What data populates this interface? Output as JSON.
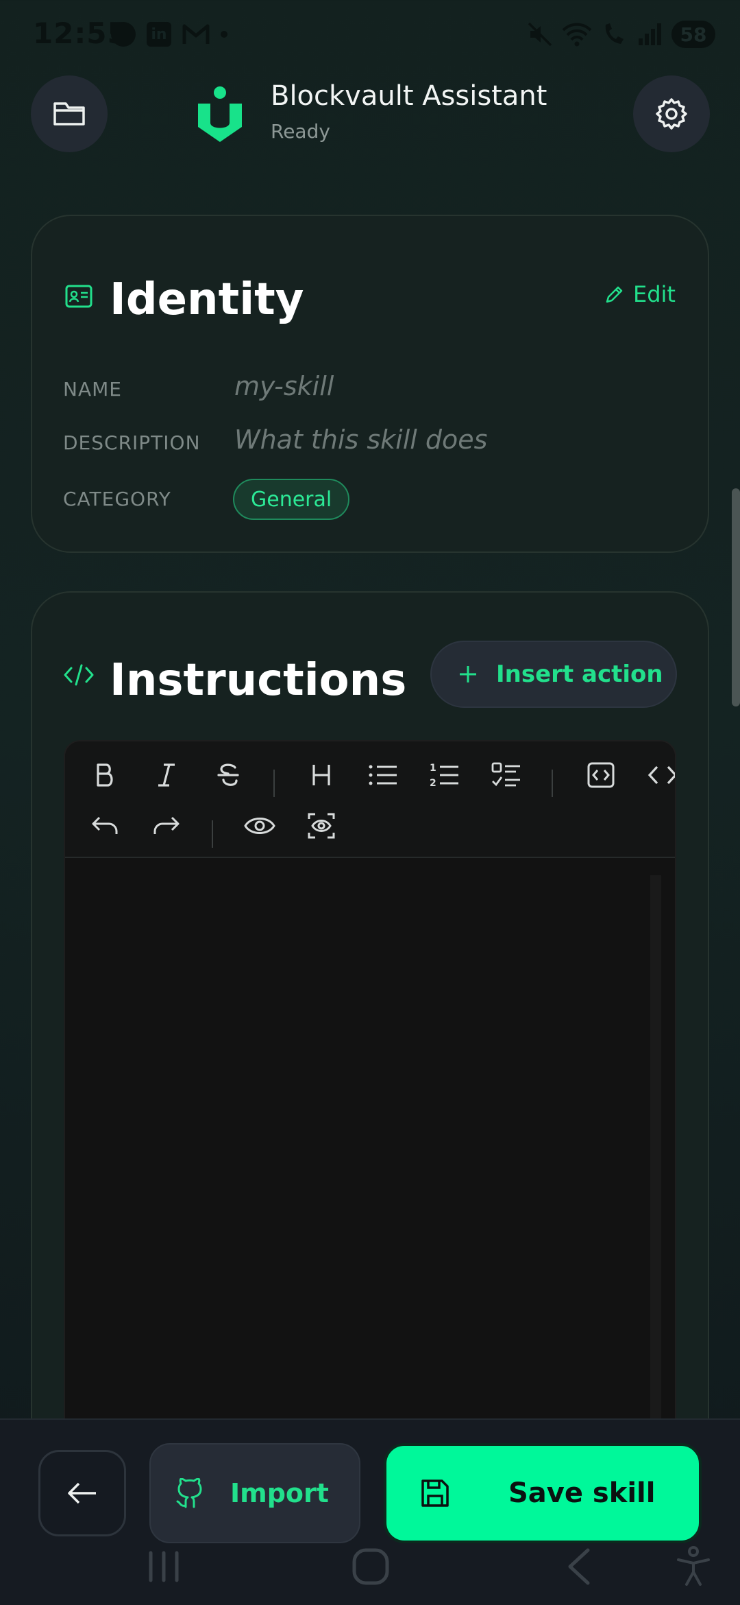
{
  "status_bar": {
    "time": "12:55",
    "battery": "58",
    "linkedin_label": "in"
  },
  "header": {
    "title": "Blockvault Assistant",
    "status": "Ready"
  },
  "identity": {
    "title": "Identity",
    "edit_label": "Edit",
    "fields": {
      "name_label": "NAME",
      "name_placeholder": "my-skill",
      "description_label": "DESCRIPTION",
      "description_placeholder": "What this skill does",
      "category_label": "CATEGORY",
      "category_value": "General"
    }
  },
  "instructions": {
    "title": "Instructions",
    "insert_action_label": "Insert action",
    "toolbar_icons": [
      "bold-icon",
      "italic-icon",
      "strikethrough-icon",
      "heading-icon",
      "bullet-list-icon",
      "numbered-list-icon",
      "checklist-icon",
      "code-block-icon",
      "inline-code-icon",
      "undo-icon",
      "redo-icon",
      "preview-icon",
      "fullscreen-preview-icon"
    ]
  },
  "bottom_actions": {
    "import_label": "Import",
    "save_label": "Save skill"
  },
  "colors": {
    "accent": "#22e08c",
    "save_button": "#00f89a",
    "background": "#142322",
    "card": "#162220"
  }
}
